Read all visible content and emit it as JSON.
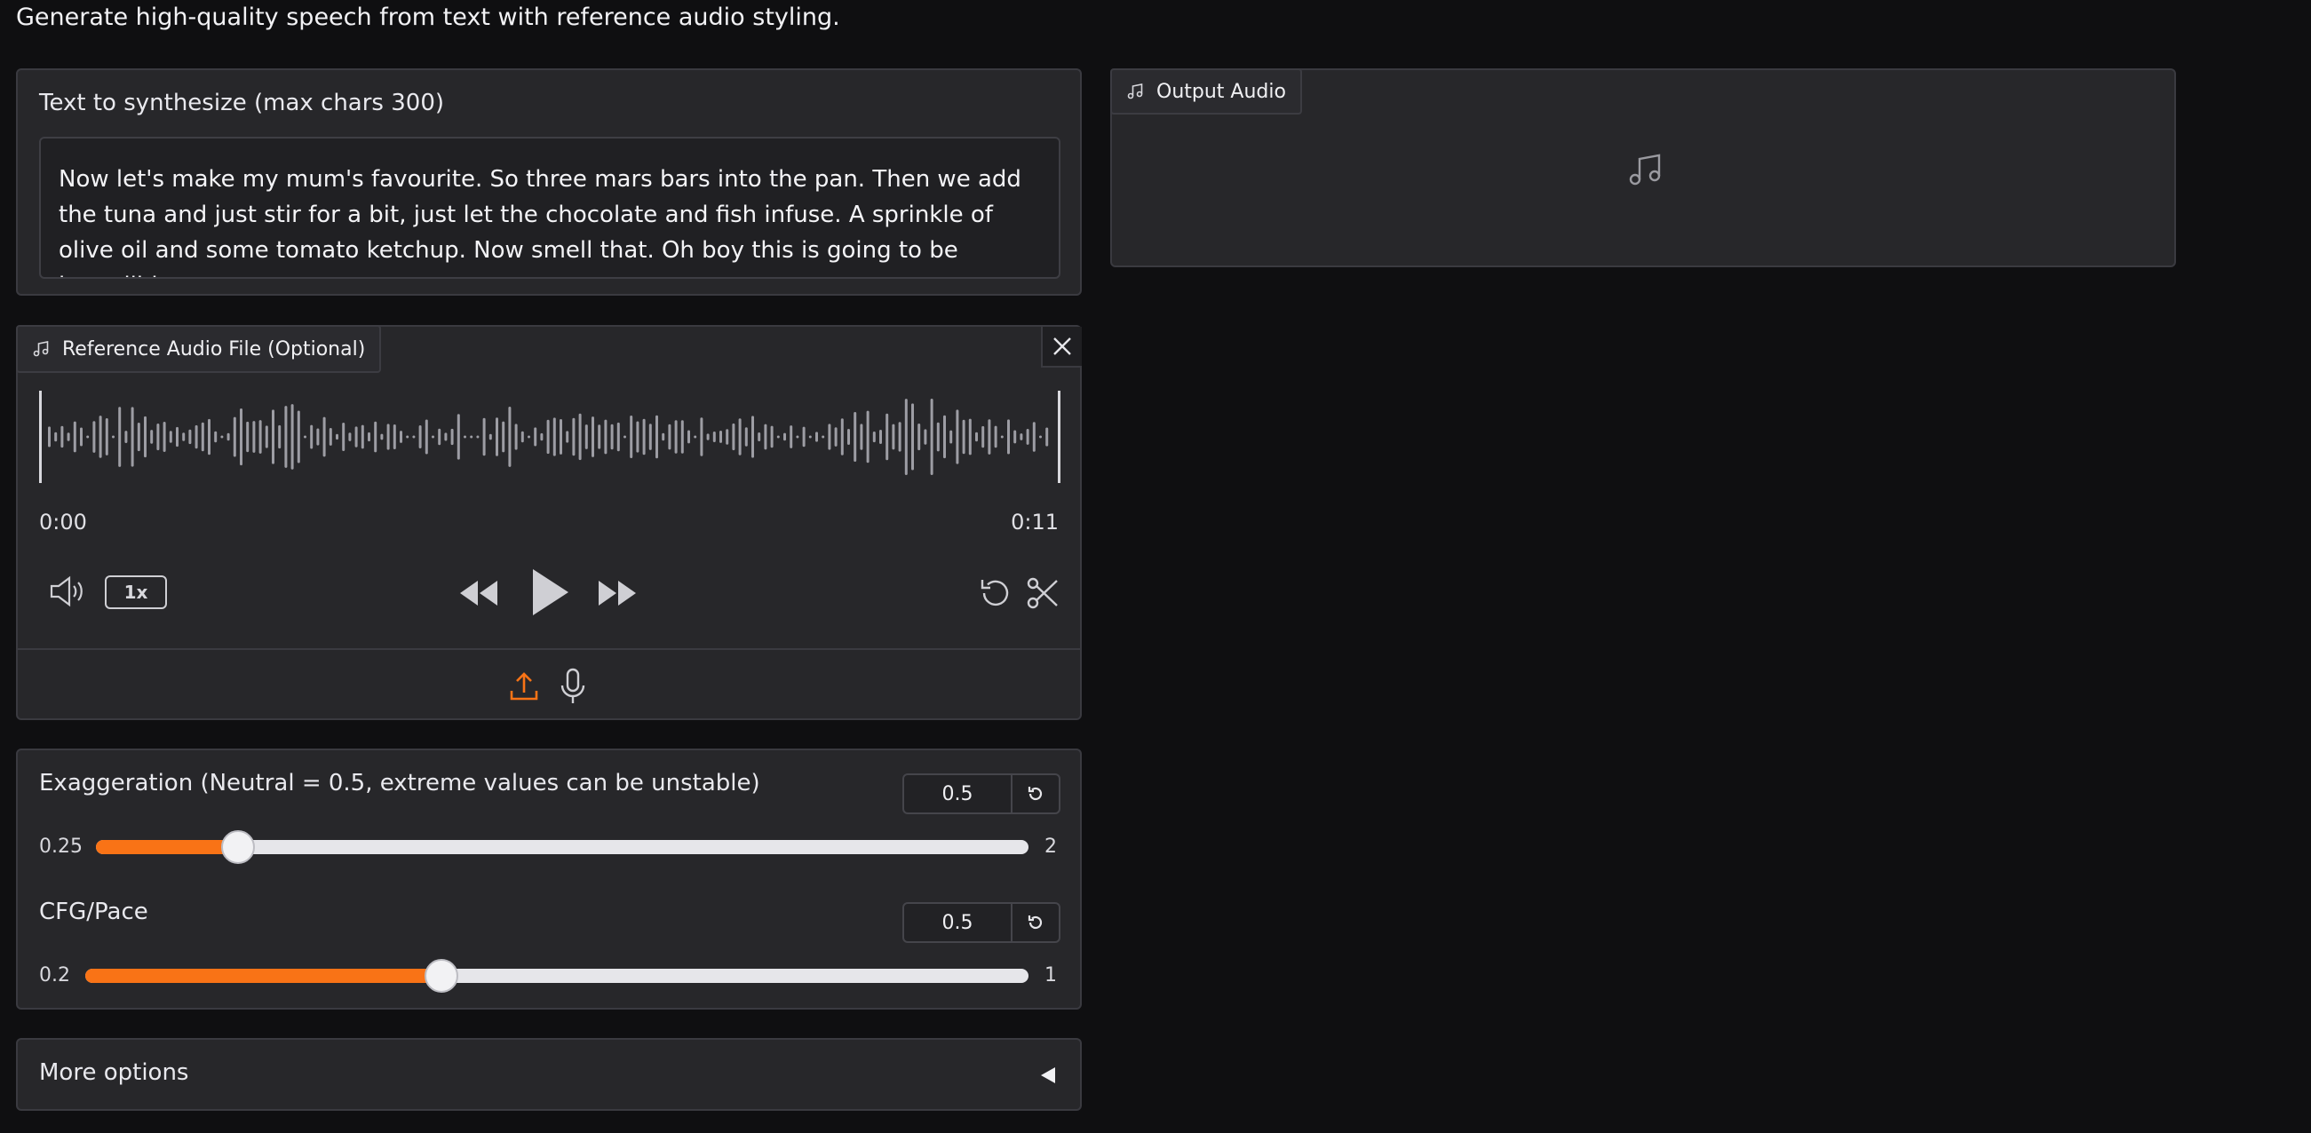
{
  "page": {
    "subtitle": "Generate high-quality speech from text with reference audio styling."
  },
  "text_input": {
    "label": "Text to synthesize (max chars 300)",
    "value": "Now let's make my mum's favourite. So three mars bars into the pan. Then we add the tuna and just stir for a bit, just let the chocolate and fish infuse. A sprinkle of olive oil and some tomato ketchup. Now smell that. Oh boy this is going to be incredible."
  },
  "reference_audio": {
    "label": "Reference Audio File (Optional)",
    "current_time": "0:00",
    "duration": "0:11",
    "playback_speed": "1x",
    "icons": [
      "music-note-icon",
      "close-icon",
      "volume-icon",
      "rewind-icon",
      "play-icon",
      "fast-forward-icon",
      "undo-icon",
      "scissors-icon",
      "upload-icon",
      "microphone-icon"
    ]
  },
  "output_audio": {
    "label": "Output Audio",
    "icon": "music-note-icon"
  },
  "sliders": {
    "exaggeration": {
      "label": "Exaggeration (Neutral = 0.5, extreme values can be unstable)",
      "value": "0.5",
      "min": "0.25",
      "max": "2"
    },
    "cfg_pace": {
      "label": "CFG/Pace",
      "value": "0.5",
      "min": "0.2",
      "max": "1"
    }
  },
  "more_options": {
    "label": "More options"
  },
  "colors": {
    "accent": "#f97316",
    "background": "#0f0f11",
    "panel": "#27272a"
  }
}
